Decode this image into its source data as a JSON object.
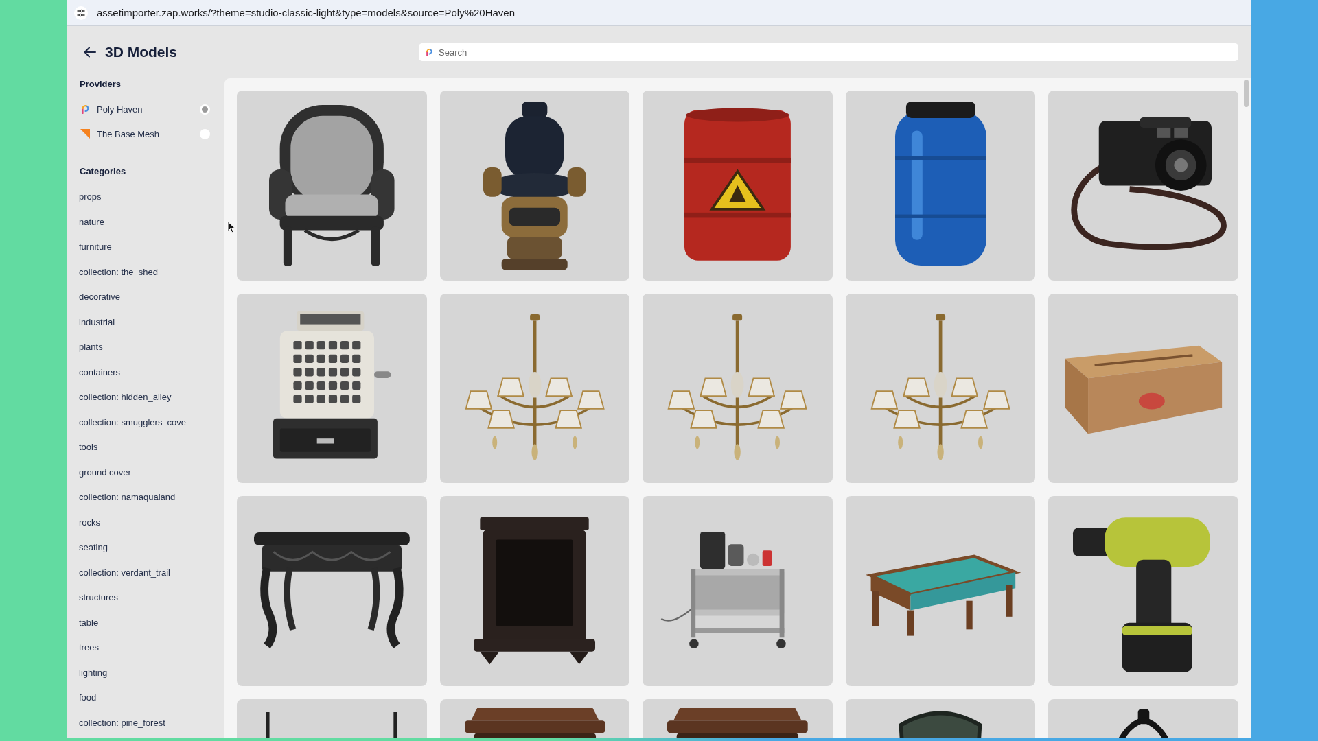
{
  "browser": {
    "url": "assetimporter.zap.works/?theme=studio-classic-light&type=models&source=Poly%20Haven"
  },
  "header": {
    "title": "3D Models",
    "search": {
      "placeholder": "Search"
    }
  },
  "sidebar": {
    "providers_heading": "Providers",
    "providers": [
      {
        "name": "Poly Haven",
        "kind": "swirl",
        "selected": true
      },
      {
        "name": "The Base Mesh",
        "kind": "wedge",
        "selected": false
      }
    ],
    "categories_heading": "Categories",
    "categories": [
      "props",
      "nature",
      "furniture",
      "collection: the_shed",
      "decorative",
      "industrial",
      "plants",
      "containers",
      "collection: hidden_alley",
      "collection: smugglers_cove",
      "tools",
      "ground cover",
      "collection: namaqualand",
      "rocks",
      "seating",
      "collection: verdant_trail",
      "structures",
      "table",
      "trees",
      "lighting",
      "food",
      "collection: pine_forest"
    ]
  },
  "models": [
    {
      "kind": "armchair"
    },
    {
      "kind": "barberchair"
    },
    {
      "kind": "drum"
    },
    {
      "kind": "barrel"
    },
    {
      "kind": "camera"
    },
    {
      "kind": "register"
    },
    {
      "kind": "chandelier"
    },
    {
      "kind": "chandelier"
    },
    {
      "kind": "chandelier"
    },
    {
      "kind": "crate"
    },
    {
      "kind": "console"
    },
    {
      "kind": "cabinet"
    },
    {
      "kind": "cart"
    },
    {
      "kind": "coffeetable"
    },
    {
      "kind": "drill"
    },
    {
      "kind": "candlesticks"
    },
    {
      "kind": "dresser"
    },
    {
      "kind": "dresser"
    },
    {
      "kind": "chair"
    },
    {
      "kind": "hoop"
    }
  ]
}
